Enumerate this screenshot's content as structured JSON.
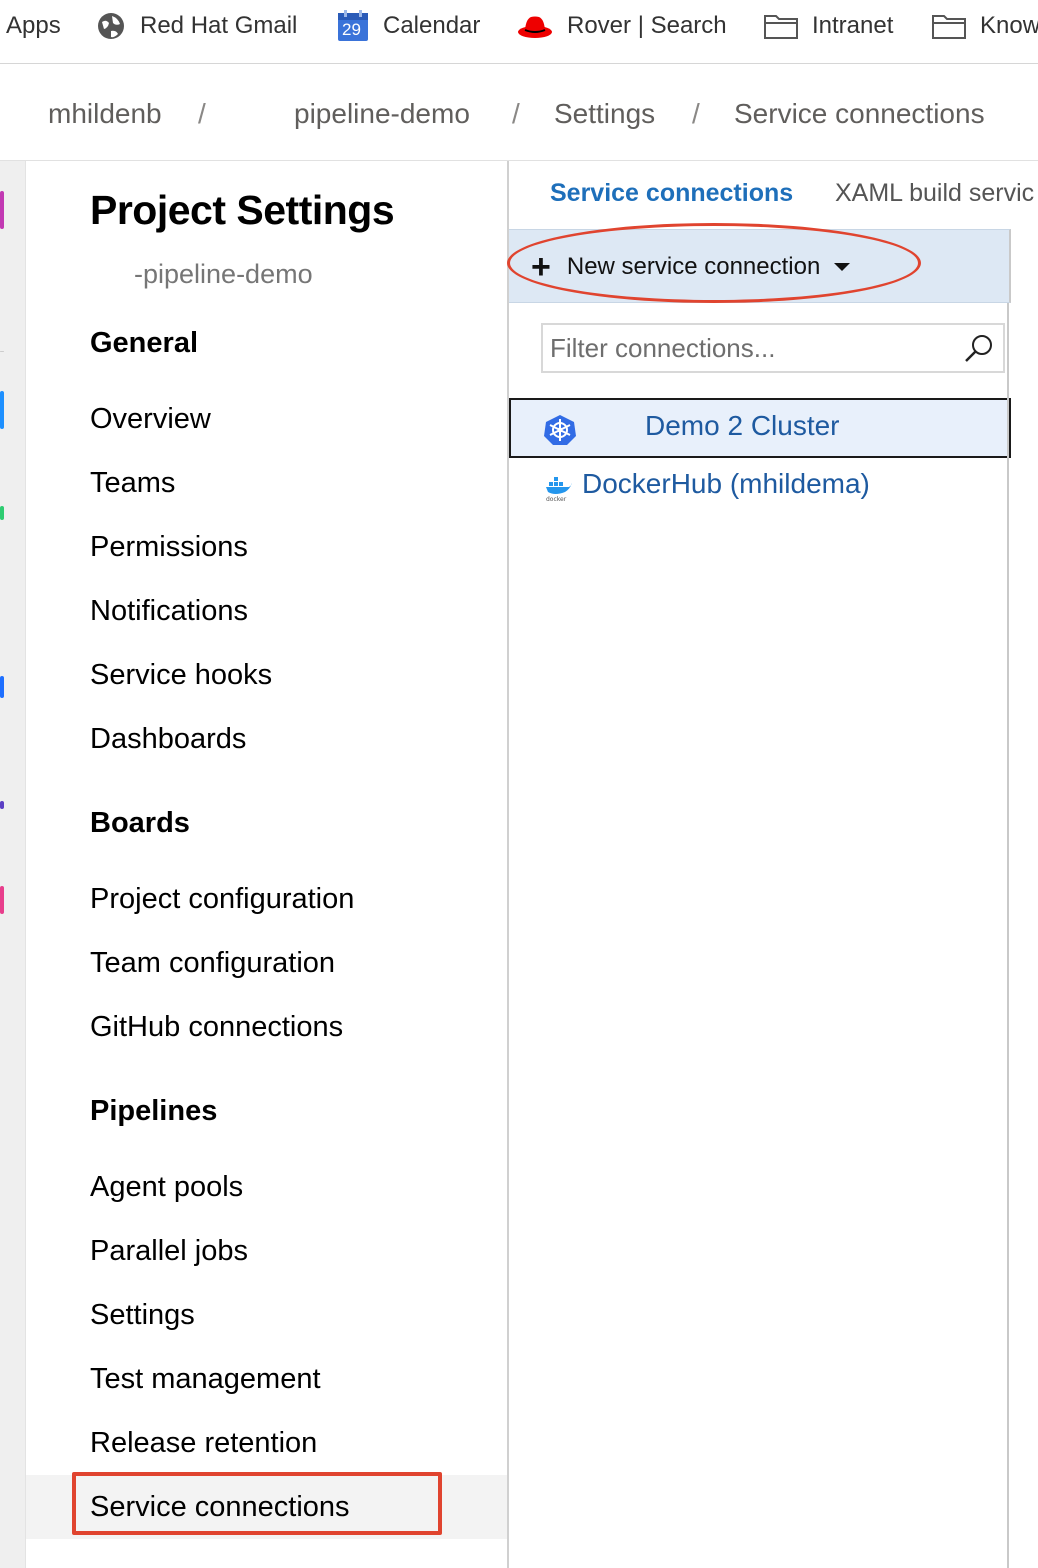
{
  "bookmarks": {
    "apps": "Apps",
    "gmail": "Red Hat Gmail",
    "calendar": "Calendar",
    "calendar_day": "29",
    "rover": "Rover | Search",
    "intranet": "Intranet",
    "know": "Know"
  },
  "breadcrumb": {
    "org": "mhildenb",
    "project": "pipeline-demo",
    "settings": "Settings",
    "page": "Service connections",
    "separator": "/"
  },
  "sidebar": {
    "title": "Project Settings",
    "subtitle": "-pipeline-demo",
    "groups": [
      {
        "heading": "General",
        "items": [
          "Overview",
          "Teams",
          "Permissions",
          "Notifications",
          "Service hooks",
          "Dashboards"
        ]
      },
      {
        "heading": "Boards",
        "items": [
          "Project configuration",
          "Team configuration",
          "GitHub connections"
        ]
      },
      {
        "heading": "Pipelines",
        "items": [
          "Agent pools",
          "Parallel jobs",
          "Settings",
          "Test management",
          "Release retention",
          "Service connections"
        ]
      }
    ],
    "active_item": "Service connections"
  },
  "content": {
    "tabs": [
      "Service connections",
      "XAML build servic"
    ],
    "new_button": "New service connection",
    "filter_placeholder": "Filter connections...",
    "connections": [
      {
        "name": "Demo 2 Cluster",
        "icon": "kubernetes-icon",
        "selected": true
      },
      {
        "name": "DockerHub (mhildema)",
        "icon": "docker-icon",
        "selected": false
      }
    ]
  },
  "colors": {
    "accent": "#1e6fba",
    "link": "#1e5aa0",
    "highlight_annotation": "#e0442f",
    "toolbar_bg": "#dde8f4"
  }
}
